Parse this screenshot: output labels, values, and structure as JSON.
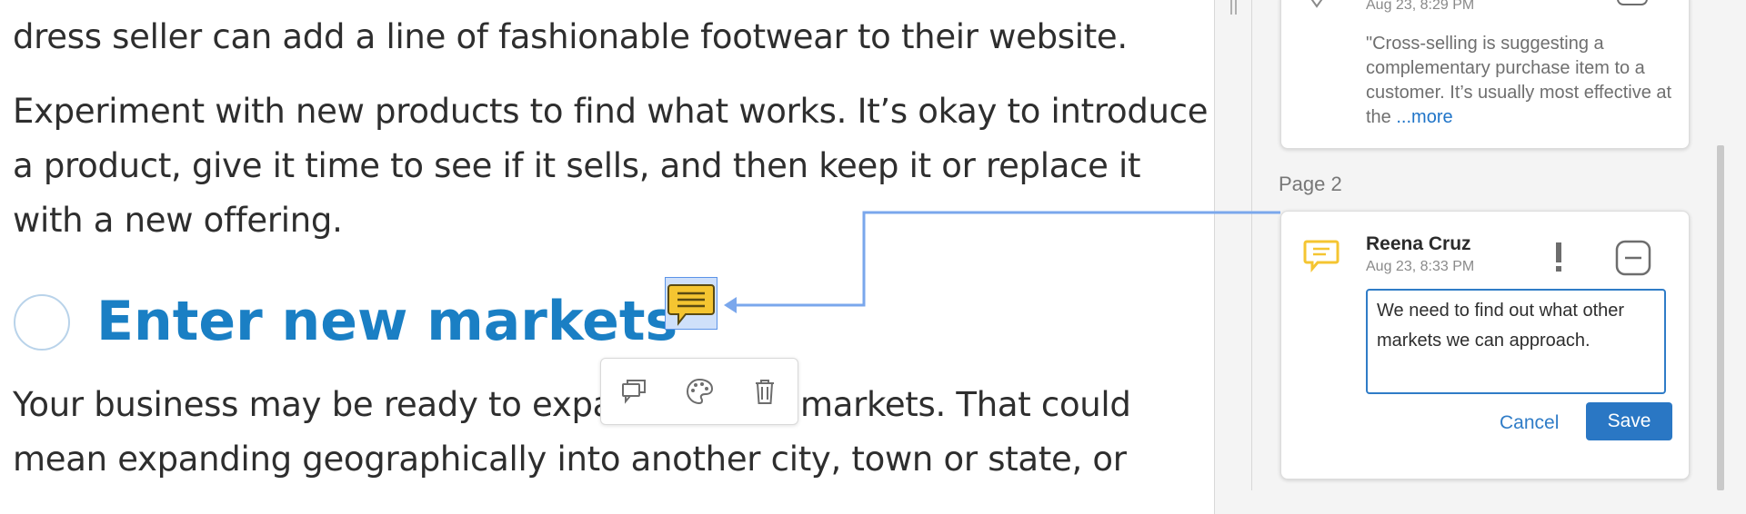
{
  "document": {
    "paragraph_1_line_2": "dress seller can add a line of fashionable footwear to their website.",
    "paragraph_2_lines": [
      "Experiment with new products to find what works. It’s okay to introduce",
      "a product, give it time to see if it sells, and then keep it or replace it",
      "with a new offering."
    ],
    "heading": "Enter new markets",
    "paragraph_3_line_1_start": "Your business may be ready to expa",
    "paragraph_3_line_1_end": "markets. That could",
    "paragraph_3_line_2": "mean expanding geographically into another city, town or state, or"
  },
  "float_toolbar": {
    "icons": [
      "comment-icon",
      "palette-icon",
      "trash-icon"
    ]
  },
  "comments_panel": {
    "previous_comment": {
      "date": "Aug 23, 8:29 PM",
      "snippet": "\"Cross-selling is suggesting a complementary purchase item to a customer. It’s usually most effective at the ",
      "more_link": "...more"
    },
    "page_label": "Page 2",
    "active_comment": {
      "author": "Reena Cruz",
      "date": "Aug 23, 8:33 PM",
      "input_value": "We need to find out what other markets we can approach.",
      "cancel_label": "Cancel",
      "save_label": "Save"
    }
  },
  "colors": {
    "accent": "#2a77c4",
    "heading": "#1a7fc4",
    "note_icon": "#f5c531",
    "connector": "#7aa7ec"
  }
}
